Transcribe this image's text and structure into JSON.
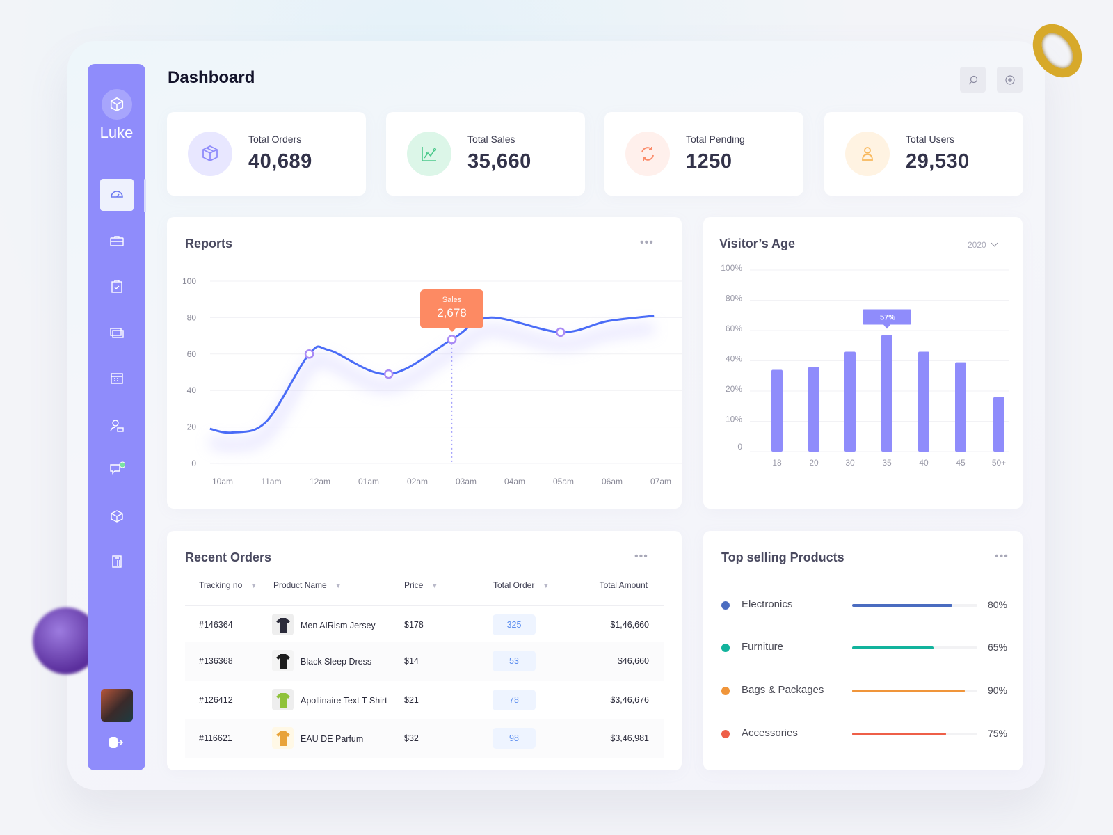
{
  "app": {
    "brand": "Luke",
    "page_title": "Dashboard"
  },
  "sidebar": {
    "items": [
      {
        "icon": "dashboard-gauge-icon",
        "active": true
      },
      {
        "icon": "briefcase-icon"
      },
      {
        "icon": "clipboard-check-icon"
      },
      {
        "icon": "screens-icon"
      },
      {
        "icon": "calendar-icon"
      },
      {
        "icon": "user-lock-icon"
      },
      {
        "icon": "chat-icon",
        "notification": true
      },
      {
        "icon": "box-icon"
      },
      {
        "icon": "calculator-icon"
      }
    ],
    "logout_icon": "logout-icon"
  },
  "header": {
    "search_icon": "search-icon",
    "add_icon": "plus-circle-icon"
  },
  "stats": [
    {
      "label": "Total Orders",
      "value": "40,689",
      "icon": "box-icon",
      "color": "#8f8cfb",
      "bg": "#e8e7ff"
    },
    {
      "label": "Total Sales",
      "value": "35,660",
      "icon": "line-chart-icon",
      "color": "#4cc98c",
      "bg": "#dcf6e8"
    },
    {
      "label": "Total Pending",
      "value": "1250",
      "icon": "refresh-icon",
      "color": "#fb8b6a",
      "bg": "#fff0ec"
    },
    {
      "label": "Total Users",
      "value": "29,530",
      "icon": "user-icon",
      "color": "#f8b85c",
      "bg": "#fff3e2"
    }
  ],
  "reports": {
    "title": "Reports",
    "menu": "•••",
    "tooltip": {
      "label": "Sales",
      "value": "2,678"
    }
  },
  "visitors": {
    "title": "Visitor’s Age",
    "year": "2020",
    "tooltip": "57%"
  },
  "chart_data": [
    {
      "type": "line",
      "title": "Reports",
      "categories": [
        "10am",
        "11am",
        "12am",
        "01am",
        "02am",
        "03am",
        "04am",
        "05am",
        "06am",
        "07am"
      ],
      "ylim": [
        0,
        100
      ],
      "yticks": [
        0,
        20,
        40,
        60,
        80,
        100
      ],
      "grid": true,
      "color": "#4a6cf7",
      "points": [
        {
          "x": -0.26,
          "y": 19
        },
        {
          "x": 0.2,
          "y": 17
        },
        {
          "x": 0.9,
          "y": 23
        },
        {
          "x": 1.78,
          "y": 60,
          "marker": true
        },
        {
          "x": 2.2,
          "y": 62
        },
        {
          "x": 3.41,
          "y": 49,
          "marker": true
        },
        {
          "x": 4.71,
          "y": 68,
          "marker": true,
          "highlight": true
        },
        {
          "x": 5.48,
          "y": 80
        },
        {
          "x": 6.94,
          "y": 72,
          "marker": true
        },
        {
          "x": 7.9,
          "y": 78
        },
        {
          "x": 8.86,
          "y": 81
        }
      ]
    },
    {
      "type": "bar",
      "title": "Visitor’s Age",
      "categories": [
        "18",
        "20",
        "30",
        "35",
        "40",
        "45",
        "50+"
      ],
      "values": [
        34,
        36,
        46,
        57,
        46,
        39,
        18
      ],
      "yticks": [
        "0",
        "10%",
        "20%",
        "40%",
        "60%",
        "80%",
        "100%"
      ],
      "ytick_values": [
        0,
        10,
        20,
        40,
        60,
        80,
        100
      ],
      "highlight": "35",
      "color": "#8f8cfb",
      "grid": true
    }
  ],
  "orders": {
    "title": "Recent Orders",
    "menu": "•••",
    "columns": [
      "Tracking no",
      "Product Name",
      "Price",
      "Total Order",
      "Total Amount"
    ],
    "rows": [
      {
        "tracking": "#146364",
        "product": "Men AIRism Jersey",
        "price": "$178",
        "total_order": "325",
        "amount": "$1,46,660",
        "thumb": "shirt-thumbnail",
        "thumb_color": "#2b2b3a",
        "thumb_bg": "#eeeeee"
      },
      {
        "tracking": "#136368",
        "product": "Black Sleep Dress",
        "price": "$14",
        "total_order": "53",
        "amount": "$46,660",
        "thumb": "dress-thumbnail",
        "thumb_color": "#1c1c1c",
        "thumb_bg": "#f4f4f4"
      },
      {
        "tracking": "#126412",
        "product": "Apollinaire Text T-Shirt",
        "price": "$21",
        "total_order": "78",
        "amount": "$3,46,676",
        "thumb": "tshirt-thumbnail",
        "thumb_color": "#8fc23a",
        "thumb_bg": "#eeeeee"
      },
      {
        "tracking": "#116621",
        "product": "EAU DE Parfum",
        "price": "$32",
        "total_order": "98",
        "amount": "$3,46,981",
        "thumb": "perfume-thumbnail",
        "thumb_color": "#e8a33a",
        "thumb_bg": "#fff8e6"
      }
    ]
  },
  "top_products": {
    "title": "Top selling Products",
    "menu": "•••",
    "items": [
      {
        "name": "Electronics",
        "percent": 80,
        "label": "80%",
        "color": "#4a6cc0"
      },
      {
        "name": "Furniture",
        "percent": 65,
        "label": "65%",
        "color": "#12b39c"
      },
      {
        "name": "Bags & Packages",
        "percent": 90,
        "label": "90%",
        "color": "#f0953a"
      },
      {
        "name": "Accessories",
        "percent": 75,
        "label": "75%",
        "color": "#ee5f48"
      }
    ]
  }
}
